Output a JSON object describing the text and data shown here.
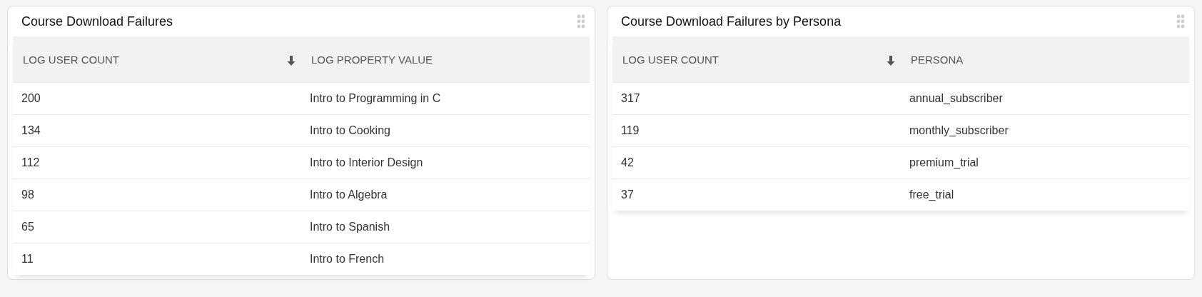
{
  "panels": [
    {
      "title": "Course Download Failures",
      "table": {
        "columns": [
          {
            "label": "LOG USER COUNT",
            "sorted": true
          },
          {
            "label": "LOG PROPERTY VALUE",
            "sorted": false
          }
        ],
        "rows": [
          [
            "200",
            "Intro to Programming in C"
          ],
          [
            "134",
            "Intro to Cooking"
          ],
          [
            "112",
            "Intro to Interior Design"
          ],
          [
            "98",
            "Intro to Algebra"
          ],
          [
            "65",
            "Intro to Spanish"
          ],
          [
            "11",
            "Intro to French"
          ]
        ]
      }
    },
    {
      "title": "Course Download Failures by Persona",
      "table": {
        "columns": [
          {
            "label": "LOG USER COUNT",
            "sorted": true
          },
          {
            "label": "PERSONA",
            "sorted": false
          }
        ],
        "rows": [
          [
            "317",
            "annual_subscriber"
          ],
          [
            "119",
            "monthly_subscriber"
          ],
          [
            "42",
            "premium_trial"
          ],
          [
            "37",
            "free_trial"
          ]
        ]
      }
    }
  ]
}
